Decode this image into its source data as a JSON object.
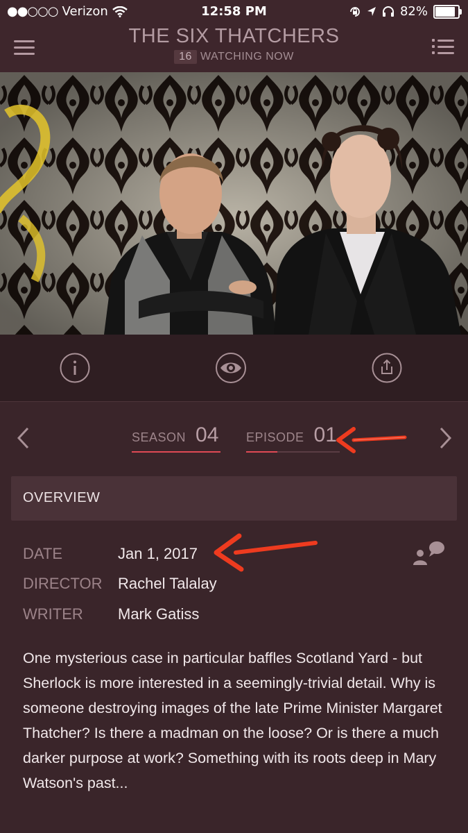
{
  "status_bar": {
    "signal": "●●○○○",
    "carrier": "Verizon",
    "time": "12:58 PM",
    "battery_percent": "82%",
    "battery_level": 0.82
  },
  "header": {
    "title": "THE SIX THATCHERS",
    "watching_count": "16",
    "watching_label": "WATCHING NOW"
  },
  "actions": {
    "info_icon": "info-icon",
    "watch_icon": "eye-icon",
    "share_icon": "share-icon"
  },
  "episode_nav": {
    "season_label": "SEASON",
    "season_value": "04",
    "episode_label": "EPISODE",
    "episode_value": "01"
  },
  "overview": {
    "heading": "OVERVIEW",
    "details": [
      {
        "label": "DATE",
        "value": "Jan 1, 2017"
      },
      {
        "label": "DIRECTOR",
        "value": "Rachel Talalay"
      },
      {
        "label": "WRITER",
        "value": "Mark Gatiss"
      }
    ],
    "description": "One mysterious case in particular baffles Scotland Yard - but Sherlock is more interested in a seemingly-trivial detail. Why is someone destroying images of the late Prime Minister Margaret Thatcher? Is there a madman on the loose? Or is there a much darker purpose at work? Something with its roots deep in Mary Watson's past..."
  },
  "colors": {
    "background": "#3a252a",
    "accent": "#e04a55",
    "annotation_arrow": "#ee3b1f"
  }
}
